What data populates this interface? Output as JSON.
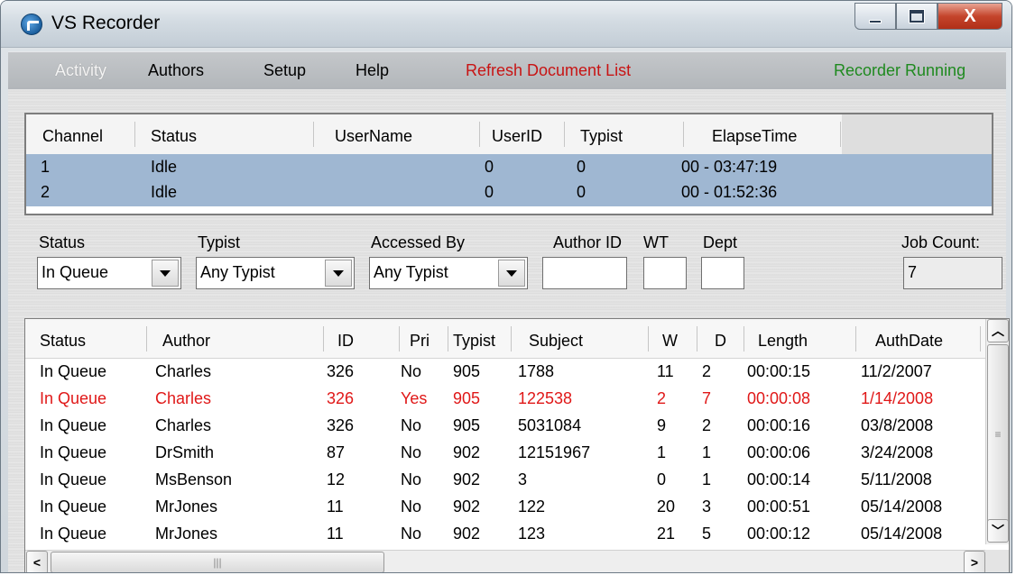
{
  "window": {
    "title": "VS Recorder",
    "close_glyph": "X"
  },
  "menu": {
    "activity": "Activity",
    "authors": "Authors",
    "setup": "Setup",
    "help": "Help",
    "refresh": "Refresh Document List",
    "status": "Recorder Running"
  },
  "channels": {
    "headers": [
      "Channel",
      "Status",
      "UserName",
      "UserID",
      "Typist",
      "ElapseTime"
    ],
    "rows": [
      {
        "channel": "1",
        "status": "Idle",
        "username": "",
        "userid": "0",
        "typist": "0",
        "elapse": "00 - 03:47:19"
      },
      {
        "channel": "2",
        "status": "Idle",
        "username": "",
        "userid": "0",
        "typist": "0",
        "elapse": "00 - 01:52:36"
      }
    ]
  },
  "filters": {
    "status_label": "Status",
    "status_value": "In Queue",
    "typist_label": "Typist",
    "typist_value": "Any Typist",
    "accessed_label": "Accessed By",
    "accessed_value": "Any Typist",
    "author_id_label": "Author ID",
    "author_id_value": "",
    "wt_label": "WT",
    "wt_value": "",
    "dept_label": "Dept",
    "dept_value": "",
    "job_count_label": "Job Count:",
    "job_count_value": "7"
  },
  "jobs": {
    "headers": [
      "Status",
      "Author",
      "ID",
      "Pri",
      "Typist",
      "Subject",
      "W",
      "D",
      "Length",
      "AuthDate"
    ],
    "rows": [
      {
        "status": "In Queue",
        "author": "Charles",
        "id": "326",
        "pri": "No",
        "typist": "905",
        "subject": "1788",
        "w": "11",
        "d": "2",
        "length": "00:00:15",
        "authdate": "11/2/2007"
      },
      {
        "status": "In Queue",
        "author": "Charles",
        "id": "326",
        "pri": "Yes",
        "typist": "905",
        "subject": "122538",
        "w": "2",
        "d": "7",
        "length": "00:00:08",
        "authdate": "1/14/2008"
      },
      {
        "status": "In Queue",
        "author": "Charles",
        "id": "326",
        "pri": "No",
        "typist": "905",
        "subject": "5031084",
        "w": "9",
        "d": "2",
        "length": "00:00:16",
        "authdate": "03/8/2008"
      },
      {
        "status": "In Queue",
        "author": "DrSmith",
        "id": "87",
        "pri": "No",
        "typist": "902",
        "subject": "12151967",
        "w": "1",
        "d": "1",
        "length": "00:00:06",
        "authdate": "3/24/2008"
      },
      {
        "status": "In Queue",
        "author": "MsBenson",
        "id": "12",
        "pri": "No",
        "typist": "902",
        "subject": "3",
        "w": "0",
        "d": "1",
        "length": "00:00:14",
        "authdate": "5/11/2008"
      },
      {
        "status": "In Queue",
        "author": "MrJones",
        "id": "11",
        "pri": "No",
        "typist": "902",
        "subject": "122",
        "w": "20",
        "d": "3",
        "length": "00:00:51",
        "authdate": "05/14/2008"
      },
      {
        "status": "In Queue",
        "author": "MrJones",
        "id": "11",
        "pri": "No",
        "typist": "902",
        "subject": "123",
        "w": "21",
        "d": "5",
        "length": "00:00:12",
        "authdate": "05/14/2008"
      }
    ]
  },
  "colors": {
    "priority_row": "#e01818",
    "refresh_link": "#c81414",
    "running_status": "#1f8a1f",
    "selected_rows": "#9fb7d2"
  },
  "icons": {
    "app": "app-globe-icon",
    "minimize": "minimize-icon",
    "maximize": "maximize-icon",
    "close": "close-icon",
    "dropdown": "chevron-down-icon",
    "scroll_up": "scroll-up-icon",
    "scroll_down": "scroll-down-icon",
    "scroll_left": "scroll-left-icon",
    "scroll_right": "scroll-right-icon"
  }
}
